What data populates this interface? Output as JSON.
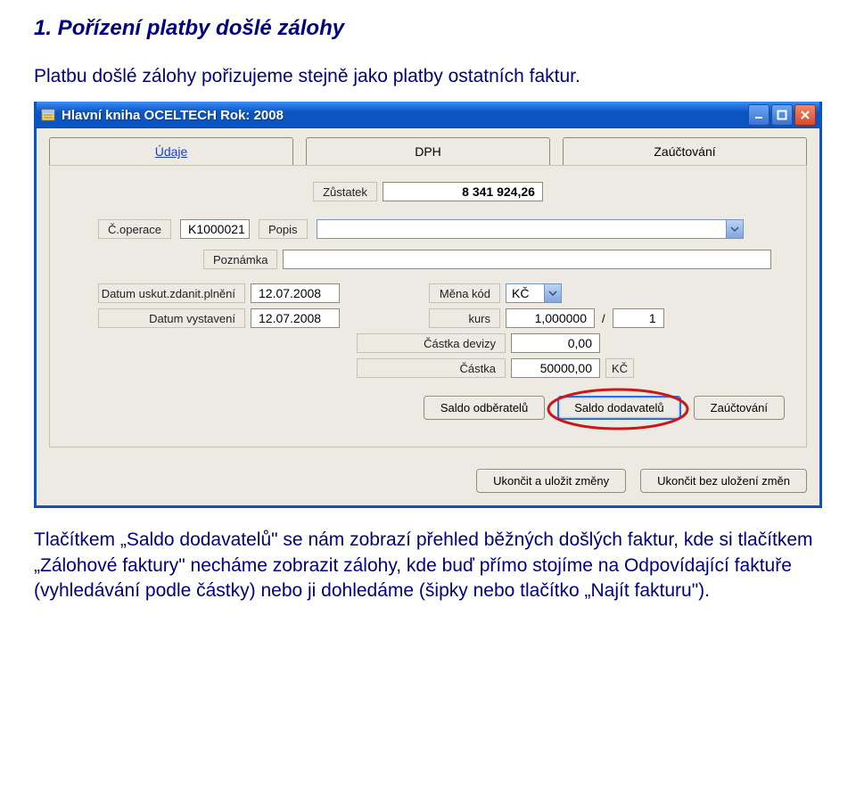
{
  "doc": {
    "heading": "1.  Pořízení platby došlé zálohy",
    "para_top": "Platbu došlé zálohy pořizujeme stejně jako platby ostatních faktur.",
    "para_bottom": "Tlačítkem „Saldo dodavatelů\" se nám zobrazí přehled běžných došlých faktur, kde si tlačítkem „Zálohové faktury\" necháme zobrazit zálohy, kde buď přímo stojíme na Odpovídající faktuře (vyhledávání podle částky) nebo ji dohledáme (šipky nebo tlačítko „Najít fakturu\")."
  },
  "window": {
    "title": "Hlavní kniha  OCELTECH  Rok: 2008"
  },
  "tabs": {
    "t1": "Údaje",
    "t2": "DPH",
    "t3": "Zaúčtování"
  },
  "balance": {
    "label": "Zůstatek",
    "value": "8 341 924,26"
  },
  "operation": {
    "op_label": "Č.operace",
    "op_value": "K1000021",
    "desc_label": "Popis",
    "desc_value": ""
  },
  "note": {
    "label": "Poznámka",
    "value": ""
  },
  "fields": {
    "date_tax_label": "Datum uskut.zdanit.plnění",
    "date_tax_value": "12.07.2008",
    "currency_label": "Měna kód",
    "currency_value": "KČ",
    "date_issue_label": "Datum vystavení",
    "date_issue_value": "12.07.2008",
    "rate_label": "kurs",
    "rate_value": "1,000000",
    "rate_sep": "/",
    "rate_per": "1",
    "amount_fx_label": "Částka devizy",
    "amount_fx_value": "0,00",
    "amount_label": "Částka",
    "amount_value": "50000,00",
    "amount_curr": "KČ"
  },
  "buttons": {
    "saldo_cust": "Saldo odběratelů",
    "saldo_supp": "Saldo dodavatelů",
    "posting": "Zaúčtování"
  },
  "footer": {
    "save": "Ukončit a uložit změny",
    "cancel": "Ukončit bez uložení změn"
  }
}
